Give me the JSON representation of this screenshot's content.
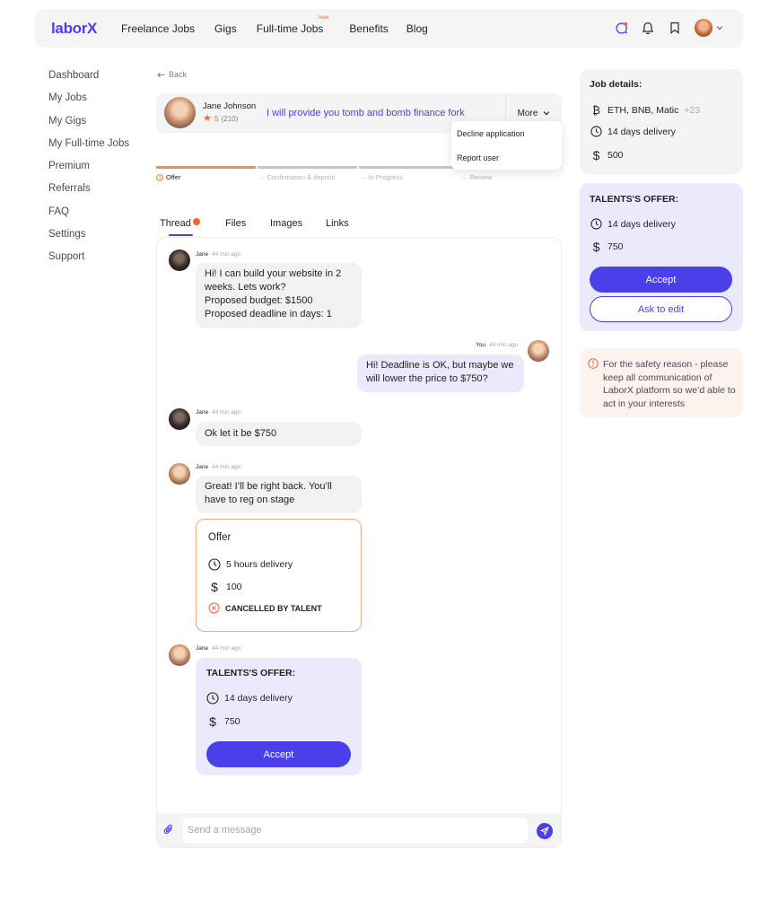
{
  "app": {
    "logo": "laborX"
  },
  "nav": {
    "items": [
      "Freelance Jobs",
      "Gigs",
      "Full-time Jobs",
      "Benefits",
      "Blog"
    ],
    "new_badge": "new"
  },
  "sidebar": {
    "items": [
      "Dashboard",
      "My Jobs",
      "My Gigs",
      "My Full-time Jobs",
      "Premium",
      "Referrals",
      "FAQ",
      "Settings",
      "Support"
    ]
  },
  "back_label": "Back",
  "job": {
    "user_name": "Jane Johnson",
    "rating": "5",
    "reviews": "(210)",
    "title": "I will provide you tomb and bomb finance fork",
    "more_label": "More"
  },
  "more_menu": [
    "Decline application",
    "Report user"
  ],
  "progress": {
    "steps": [
      "Offer",
      "Confirmation & deposit",
      "In Progress",
      "Review"
    ],
    "active": 0
  },
  "tabs": [
    "Thread",
    "Files",
    "Images",
    "Links"
  ],
  "thread": {
    "messages": [
      {
        "author": "Jane",
        "time": "44 min ago",
        "lines": [
          "Hi! I can build your website in 2",
          "weeks. Lets work?",
          "Proposed budget: $1500",
          "Proposed deadline in days: 1"
        ]
      },
      {
        "author": "You",
        "time": "44 min ago",
        "lines": [
          "Hi! Deadline is OK, but maybe we",
          "will lower the price to $750?"
        ]
      },
      {
        "author": "Jane",
        "time": "44 min ago",
        "lines": [
          "Ok let it be $750"
        ]
      },
      {
        "author": "Jane",
        "time": "44 min ago",
        "lines": [
          "Great! I’ll be right back. You’ll",
          "have to reg on stage"
        ]
      },
      {
        "author": "Jane",
        "time": "44 min ago"
      }
    ],
    "offer": {
      "title": "Offer",
      "delivery": "5 hours delivery",
      "amount": "100",
      "status": "CANCELLED BY TALENT"
    },
    "talent_offer": {
      "title": "TALENTS'S OFFER:",
      "delivery": "14 days delivery",
      "amount": "750",
      "accept": "Accept"
    },
    "composer_placeholder": "Send a message"
  },
  "job_details": {
    "title": "Job details:",
    "currencies": "ETH, BNB, Matic",
    "currencies_more": "+23",
    "delivery": "14 days delivery",
    "budget": "500"
  },
  "talent_offer_panel": {
    "title": "TALENTS'S OFFER:",
    "delivery": "14 days delivery",
    "amount": "750",
    "accept": "Accept",
    "ask_edit": "Ask to edit"
  },
  "safety": {
    "text": "For the safety reason - please keep all communication of LaborX platform so we’d able to act in your interests"
  },
  "colors": {
    "accent": "#4a3fe8",
    "accent_soft": "#ebeafd",
    "warning": "#ef6a2a",
    "panel": "#f4f4f6"
  }
}
